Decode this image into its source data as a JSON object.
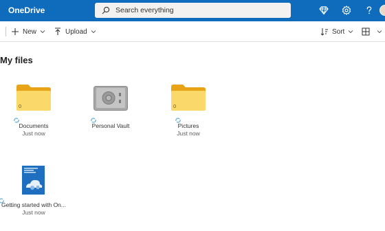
{
  "header": {
    "brand": "OneDrive",
    "search_placeholder": "Search everything",
    "icons": [
      "diamond-icon",
      "gear-icon",
      "help-icon",
      "avatar"
    ],
    "colors": {
      "header_bg": "#0f6cbd",
      "search_bg": "#f3f2f1"
    }
  },
  "commands": {
    "new_label": "New",
    "upload_label": "Upload",
    "sort_label": "Sort"
  },
  "page": {
    "title": "My files"
  },
  "items": [
    {
      "name": "Documents",
      "date": "Just now",
      "count": "0",
      "kind": "folder"
    },
    {
      "name": "Personal Vault",
      "date": "",
      "kind": "vault"
    },
    {
      "name": "Pictures",
      "date": "Just now",
      "count": "0",
      "kind": "folder"
    },
    {
      "name": "Getting started with On...",
      "date": "Just now",
      "kind": "document"
    }
  ]
}
